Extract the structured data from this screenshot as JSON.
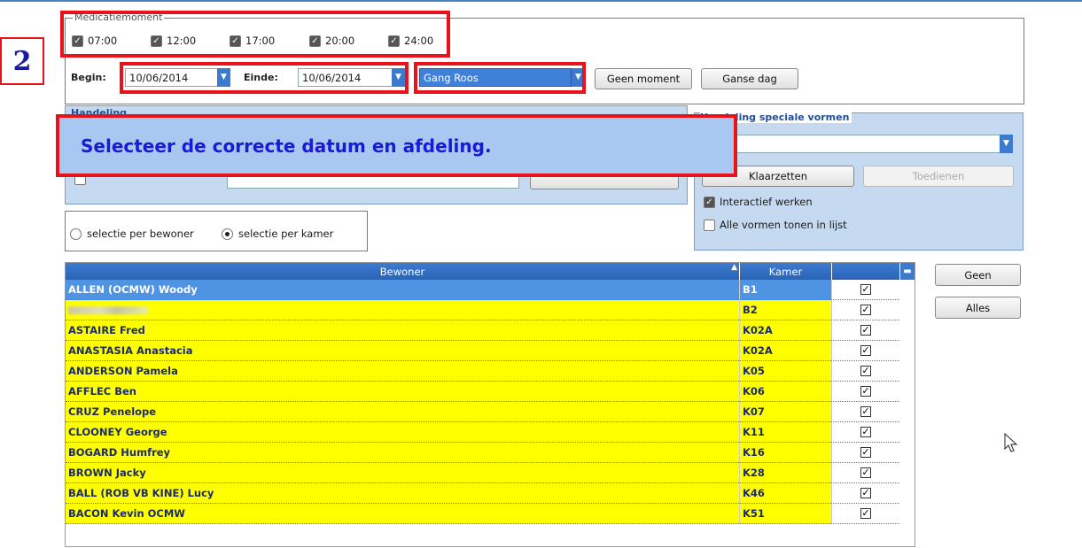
{
  "step_number": "2",
  "instruction": "Selecteer de correcte datum en afdeling.",
  "medication_moment": {
    "title": "Medicatiemoment",
    "times": [
      "07:00",
      "12:00",
      "17:00",
      "20:00",
      "24:00"
    ]
  },
  "period": {
    "begin_label": "Begin:",
    "begin_value": "10/06/2014",
    "end_label": "Einde:",
    "end_value": "10/06/2014",
    "department": "Gang Roos",
    "no_moment_button": "Geen moment",
    "whole_day_button": "Ganse dag"
  },
  "handling_panel": {
    "title": "Handeling"
  },
  "special_panel": {
    "title": "Handeling speciale vormen",
    "prepare_button": "Klaarzetten",
    "administer_button": "Toedienen",
    "interactive_label": "Interactief werken",
    "show_all_label": "Alle vormen tonen in lijst"
  },
  "selection": {
    "per_resident": "selectie per bewoner",
    "per_room": "selectie per kamer"
  },
  "grid": {
    "col_resident": "Bewoner",
    "col_room": "Kamer",
    "rows": [
      {
        "name": "ALLEN (OCMW) Woody",
        "room": "B1"
      },
      {
        "name": "",
        "room": "B2"
      },
      {
        "name": "ASTAIRE Fred",
        "room": "K02A"
      },
      {
        "name": "ANASTASIA Anastacia",
        "room": "K02A"
      },
      {
        "name": "ANDERSON Pamela",
        "room": "K05"
      },
      {
        "name": "AFFLEC Ben",
        "room": "K06"
      },
      {
        "name": "CRUZ Penelope",
        "room": "K07"
      },
      {
        "name": "CLOONEY George",
        "room": "K11"
      },
      {
        "name": "BOGARD Humfrey",
        "room": "K16"
      },
      {
        "name": "BROWN Jacky",
        "room": "K28"
      },
      {
        "name": "BALL (ROB VB KINE) Lucy",
        "room": "K46"
      },
      {
        "name": "BACON Kevin OCMW",
        "room": "K51"
      }
    ]
  },
  "side_buttons": {
    "none": "Geen",
    "all": "Alles"
  },
  "colors": {
    "highlight": "#e8121b",
    "selected_row": "#4f93e3",
    "row_yellow": "#ffff00"
  }
}
